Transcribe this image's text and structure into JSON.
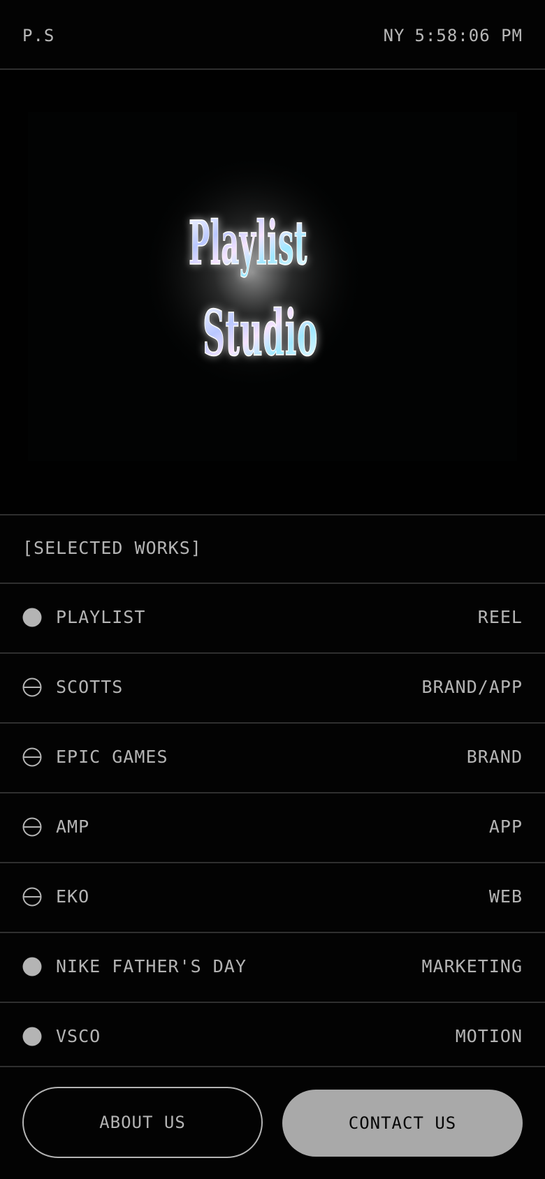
{
  "header": {
    "logo": "P.S",
    "city": "NY",
    "time": "5:58:06 PM"
  },
  "hero": {
    "logo_line1": "Playlist",
    "logo_line2": "Studio"
  },
  "section": {
    "title": "[SELECTED WORKS]"
  },
  "works": [
    {
      "name": "PLAYLIST",
      "category": "REEL",
      "icon": "filled-circle-icon"
    },
    {
      "name": "SCOTTS",
      "category": "BRAND/APP",
      "icon": "minus-circle-icon"
    },
    {
      "name": "EPIC GAMES",
      "category": "BRAND",
      "icon": "minus-circle-icon"
    },
    {
      "name": "AMP",
      "category": "APP",
      "icon": "minus-circle-icon"
    },
    {
      "name": "EKO",
      "category": "WEB",
      "icon": "minus-circle-icon"
    },
    {
      "name": "NIKE FATHER'S DAY",
      "category": "MARKETING",
      "icon": "filled-circle-icon"
    },
    {
      "name": "VSCO",
      "category": "MOTION",
      "icon": "filled-circle-icon"
    }
  ],
  "buttons": {
    "about": "ABOUT US",
    "contact": "CONTACT US"
  },
  "colors": {
    "background": "#030303",
    "text": "#b4b4b4",
    "divider": "#2f2f2f",
    "contact_button": "#a9a9a9"
  }
}
